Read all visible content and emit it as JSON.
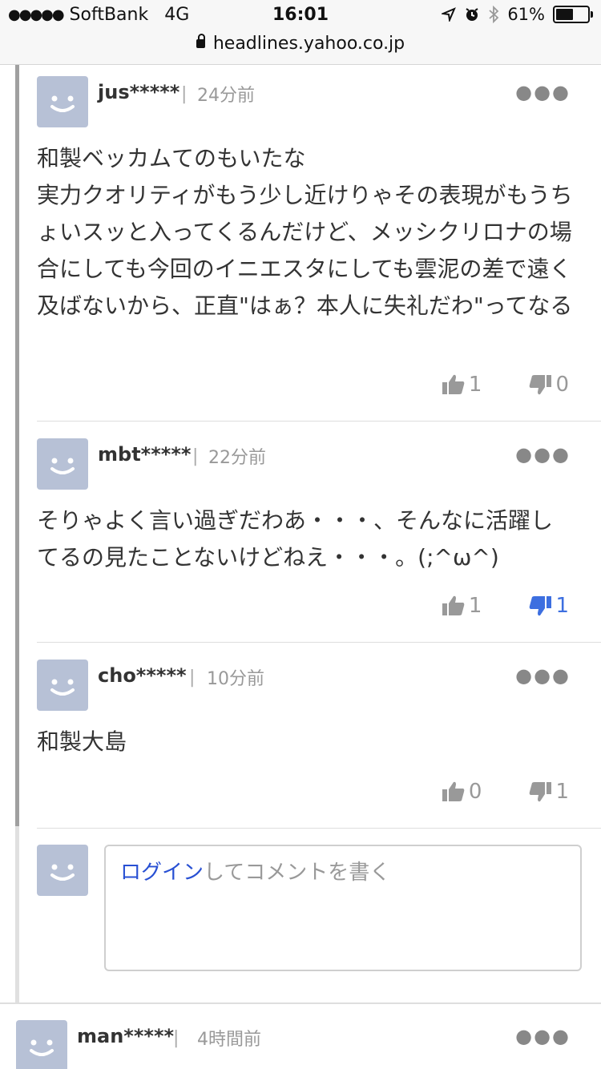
{
  "status_bar": {
    "signal_dots": "●●●●●",
    "carrier": "SoftBank",
    "network": "4G",
    "time": "16:01",
    "battery": "61%",
    "battery_level": 0.61
  },
  "address_bar": {
    "url": "headlines.yahoo.co.jp"
  },
  "comments": [
    {
      "user": "jus*****",
      "time": "24分前",
      "text": "和製ベッカムてのもいたな\n実力クオリティがもう少し近けりゃその表現がもうちょいスッと入ってくるんだけど、メッシクリロナの場合にしても今回のイニエスタにしても雲泥の差で遠く及ばないから、正直\"はぁ？本人に失礼だわ\"ってなる",
      "likes": "1",
      "dislikes": "0"
    },
    {
      "user": "mbt*****",
      "time": "22分前",
      "text": "そりゃよく言い過ぎだわあ・・・、そんなに活躍してるの見たことないけどねえ・・・。(;^ω^)",
      "likes": "1",
      "dislikes": "1"
    },
    {
      "user": "cho*****",
      "time": "10分前",
      "text": "和製大島",
      "likes": "0",
      "dislikes": "1"
    }
  ],
  "reply_box": {
    "login_label": "ログイン",
    "placeholder": "してコメントを書く"
  },
  "next_comment": {
    "user": "man*****",
    "time": "4時間前"
  },
  "menu_icon": "more-dots-icon",
  "colors": {
    "avatar_bg": "#b7c1d6",
    "link": "#2850d3",
    "active_vote": "#3d6fe0"
  }
}
